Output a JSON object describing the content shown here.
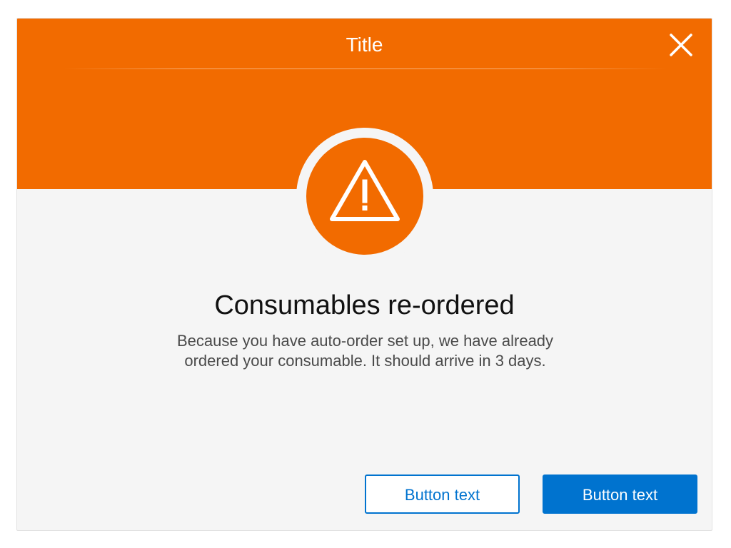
{
  "dialog": {
    "title": "Title",
    "close_icon": "close-icon",
    "status_icon": "warning-triangle-icon",
    "heading": "Consumables re-ordered",
    "message_line_1": "Because you have auto-order set up, we have already",
    "message_line_2": "ordered your consumable. It should arrive in 3 days.",
    "secondary_button_label": "Button text",
    "primary_button_label": "Button text"
  },
  "colors": {
    "header": "#f26b00",
    "background": "#f5f5f5",
    "primary": "#0073cf",
    "heading_text": "#111111",
    "body_text": "#4a4a4a"
  }
}
